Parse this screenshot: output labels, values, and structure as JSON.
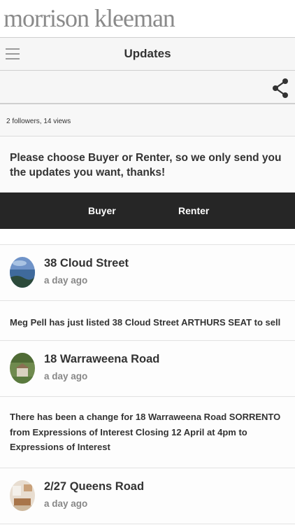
{
  "brand": {
    "logo_text": "morrison kleeman"
  },
  "header": {
    "title": "Updates",
    "menu_icon": "hamburger-menu-icon",
    "share_icon": "share-icon"
  },
  "stats": {
    "text": "2 followers, 14 views"
  },
  "prompt": {
    "text": "Please choose Buyer or Renter, so we only send you the updates you want, thanks!"
  },
  "choices": {
    "buyer": "Buyer",
    "renter": "Renter"
  },
  "updates": [
    {
      "title": "38 Cloud Street",
      "time": "a day ago",
      "body": "Meg Pell has just listed 38 Cloud Street ARTHURS SEAT to sell"
    },
    {
      "title": "18 Warraweena Road",
      "time": "a day ago",
      "body": "There has been a change for 18 Warraweena Road SORRENTO from Expressions of Interest Closing 12 April at 4pm to Expressions of Interest"
    },
    {
      "title": "2/27 Queens Road",
      "time": "a day ago"
    }
  ],
  "colors": {
    "choice_bar": "#262626",
    "logo": "#8a8a8a",
    "muted": "#888888"
  }
}
